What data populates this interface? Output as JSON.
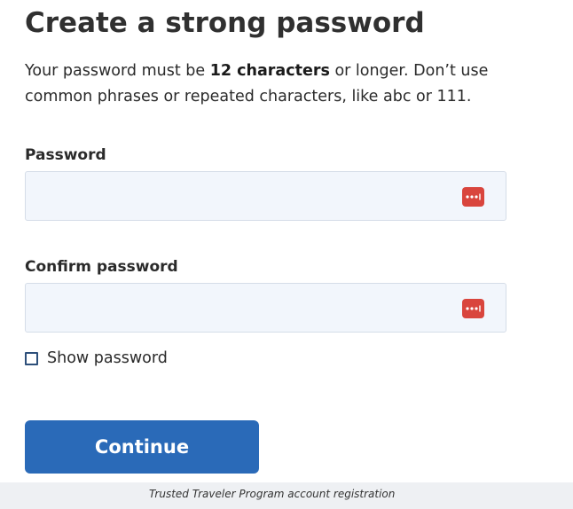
{
  "page": {
    "title": "Create a strong password",
    "intro": {
      "prefix": "Your password must be ",
      "bold": "12 characters",
      "suffix": " or longer. Don’t use common phrases or repeated characters, like abc or 111."
    }
  },
  "form": {
    "password": {
      "label": "Password",
      "value": "",
      "icon": "password-manager-icon"
    },
    "confirm_password": {
      "label": "Confirm password",
      "value": "",
      "icon": "password-manager-icon"
    },
    "show_password": {
      "label": "Show password",
      "checked": false
    },
    "continue_label": "Continue"
  },
  "footer": {
    "caption": "Trusted Traveler Program account registration"
  },
  "colors": {
    "primary_button": "#2a6ab8",
    "input_background": "#f2f6fc",
    "password_manager_icon": "#d9453d",
    "footer_background": "#eef0f3"
  }
}
